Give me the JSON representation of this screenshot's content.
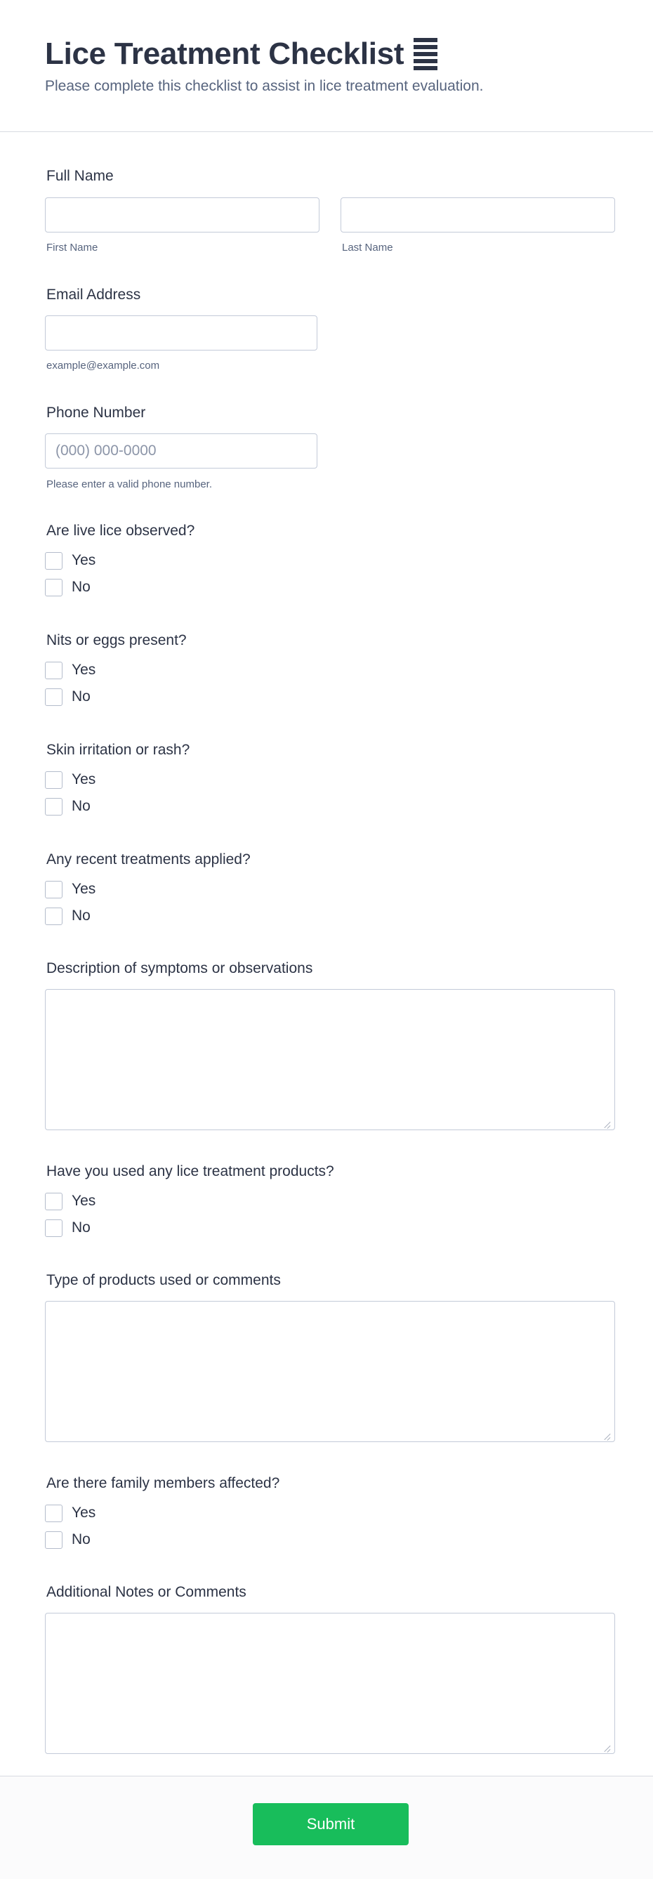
{
  "header": {
    "title": "Lice Treatment Checklist",
    "subtitle": "Please complete this checklist to assist in lice treatment evaluation."
  },
  "full_name": {
    "label": "Full Name",
    "first_sublabel": "First Name",
    "last_sublabel": "Last Name",
    "first_value": "",
    "last_value": ""
  },
  "email": {
    "label": "Email Address",
    "sublabel": "example@example.com",
    "value": ""
  },
  "phone": {
    "label": "Phone Number",
    "placeholder": "(000) 000-0000",
    "sublabel": "Please enter a valid phone number.",
    "value": ""
  },
  "questions": [
    {
      "label": "Are live lice observed?",
      "options": [
        "Yes",
        "No"
      ]
    },
    {
      "label": "Nits or eggs present?",
      "options": [
        "Yes",
        "No"
      ]
    },
    {
      "label": "Skin irritation or rash?",
      "options": [
        "Yes",
        "No"
      ]
    },
    {
      "label": "Any recent treatments applied?",
      "options": [
        "Yes",
        "No"
      ]
    },
    {
      "label": "Description of symptoms or observations"
    },
    {
      "label": "Have you used any lice treatment products?",
      "options": [
        "Yes",
        "No"
      ]
    },
    {
      "label": "Type of products used or comments"
    },
    {
      "label": "Are there family members affected?",
      "options": [
        "Yes",
        "No"
      ]
    },
    {
      "label": "Additional Notes or Comments"
    }
  ],
  "footer": {
    "submit_label": "Submit"
  },
  "icons": {
    "title_icon": "list-lines-icon",
    "textarea_resize": "resize-grip-icon"
  },
  "colors": {
    "text": "#2c3345",
    "muted": "#57647e",
    "border": "#c3cad8",
    "submit": "#18bd5b"
  }
}
